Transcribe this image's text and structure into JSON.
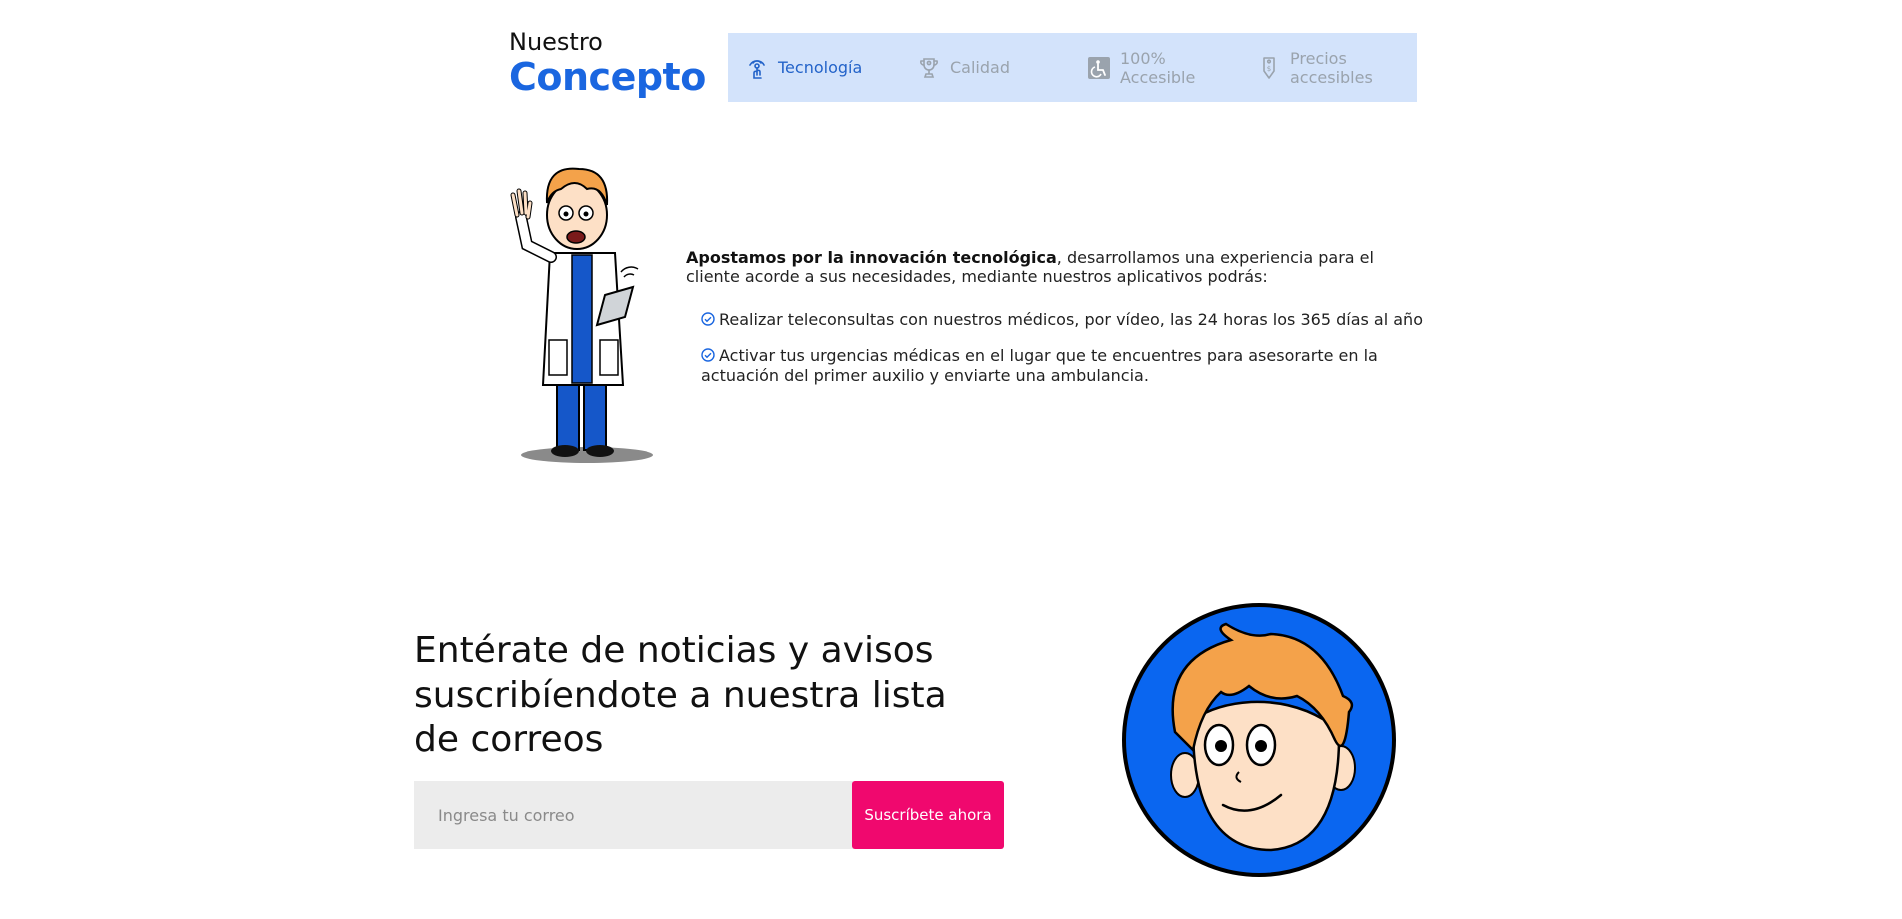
{
  "concept": {
    "small": "Nuestro",
    "big": "Concepto"
  },
  "tabs": [
    {
      "label": "Tecnología",
      "icon": "touch-icon",
      "active": true
    },
    {
      "label": "Calidad",
      "icon": "trophy-icon",
      "active": false
    },
    {
      "label": "100% Accesible",
      "icon": "wheelchair-icon",
      "active": false
    },
    {
      "label": "Precios accesibles",
      "icon": "price-tag-icon",
      "active": false
    }
  ],
  "intro": {
    "bold": "Apostamos por la innovación tecnológica",
    "rest": ", desarrollamos una experiencia para el cliente acorde a sus necesidades, mediante nuestros aplicativos podrás:"
  },
  "bullets": [
    "Realizar teleconsultas con nuestros médicos, por vídeo, las 24 horas los 365 días al año",
    "Activar tus urgencias médicas en el lugar que te encuentres para asesorarte en la actuación del primer auxilio y enviarte una ambulancia."
  ],
  "newsletter": {
    "title": "Entérate de noticias y avisos suscribíendote a nuestra lista de correos",
    "placeholder": "Ingresa tu correo",
    "button": "Suscríbete ahora"
  },
  "colors": {
    "brand_blue": "#1a66e0",
    "tab_bar": "#d3e3fb",
    "cta_pink": "#f0086e",
    "avatar_circle": "#0a66f0"
  }
}
